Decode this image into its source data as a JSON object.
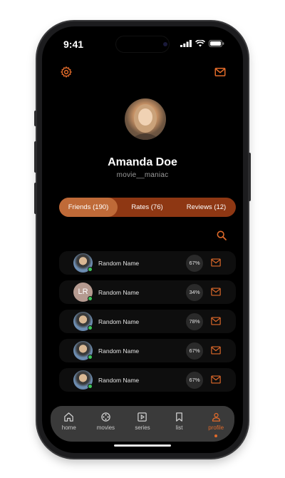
{
  "status": {
    "time": "9:41"
  },
  "profile": {
    "name": "Amanda Doe",
    "username": "movie__maniac"
  },
  "tabs": [
    {
      "label": "Friends (190)",
      "active": true
    },
    {
      "label": "Rates (76)",
      "active": false
    },
    {
      "label": "Reviews (12)",
      "active": false
    }
  ],
  "friends": [
    {
      "name": "Random Name",
      "avatar": "photo",
      "initials": "",
      "match": "67%",
      "online": true
    },
    {
      "name": "Random Name",
      "avatar": "initials",
      "initials": "LR",
      "match": "34%",
      "online": true
    },
    {
      "name": "Random Name",
      "avatar": "photo",
      "initials": "",
      "match": "78%",
      "online": true
    },
    {
      "name": "Random Name",
      "avatar": "photo",
      "initials": "",
      "match": "67%",
      "online": true
    },
    {
      "name": "Random Name",
      "avatar": "photo",
      "initials": "",
      "match": "67%",
      "online": true
    }
  ],
  "nav": [
    {
      "label": "home",
      "icon": "home-icon",
      "active": false
    },
    {
      "label": "movies",
      "icon": "film-reel-icon",
      "active": false
    },
    {
      "label": "series",
      "icon": "play-square-icon",
      "active": false
    },
    {
      "label": "list",
      "icon": "bookmark-icon",
      "active": false
    },
    {
      "label": "profile",
      "icon": "user-icon",
      "active": true
    }
  ],
  "colors": {
    "accent": "#e06a2a",
    "tabs_bg": "#8e3713",
    "tab_active": "#bf6a38",
    "online": "#3ec35a"
  }
}
